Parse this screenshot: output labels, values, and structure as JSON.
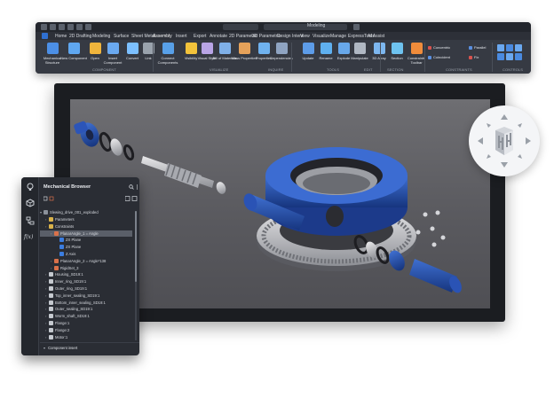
{
  "ribbon": {
    "workspace": "Modeling",
    "tabs": [
      "Home",
      "2D Drafting",
      "Modeling",
      "Surface",
      "Sheet Metal",
      "Assembly",
      "Insert",
      "Export",
      "Annotate",
      "2D Parametric",
      "3D Parametric",
      "Design Intent",
      "View",
      "Visualize",
      "Manage",
      "ExpressTools",
      "AI Assist"
    ],
    "active_tab": "Assembly",
    "tools": [
      "Mechanical Structure",
      "New Component",
      "Open",
      "Insert Component",
      "Convert",
      "Link",
      "Connect Components",
      "Visibility",
      "Visual Style",
      "Bill of Materials",
      "Mass Properties",
      "Properties",
      "Dependencies",
      "Update",
      "Rename",
      "Explode",
      "Manipulate",
      "3D Array",
      "Section",
      "Constraints Toolbar"
    ],
    "constraints": [
      "Concentric",
      "Parallel",
      "Coincident",
      "Fix"
    ],
    "groups": [
      "COMPONENT",
      "VISUALIZE",
      "INQUIRE",
      "TOOLS",
      "EDIT",
      "SECTION",
      "CONSTRAINTS",
      "CONTROLS"
    ],
    "colors": {
      "bg": "#363a43",
      "accent": "#2f6fd0"
    }
  },
  "browser": {
    "title": "Mechanical Browser",
    "root": "Slewing_drive_001_exploded",
    "items": [
      {
        "label": "Parameters",
        "indent": 1,
        "icon": "folder-icon"
      },
      {
        "label": "Constraints",
        "indent": 1,
        "icon": "folder-icon"
      },
      {
        "label": "PlanarAngle_1 = Angle",
        "indent": 2,
        "icon": "constraint-icon",
        "selected": true
      },
      {
        "label": "ZX Plane",
        "indent": 3,
        "icon": "plane-icon"
      },
      {
        "label": "ZX Plane",
        "indent": 3,
        "icon": "plane-icon"
      },
      {
        "label": "Z Axis",
        "indent": 3,
        "icon": "axis-icon"
      },
      {
        "label": "PlanarAngle_2 = Angle*138",
        "indent": 2,
        "icon": "constraint-icon"
      },
      {
        "label": "RigidSet_3",
        "indent": 2,
        "icon": "constraint-icon"
      },
      {
        "label": "Housing_SD19:1",
        "indent": 1,
        "icon": "part-icon"
      },
      {
        "label": "Inner_ring_SD19:1",
        "indent": 1,
        "icon": "part-icon"
      },
      {
        "label": "Outer_ring_SD19:1",
        "indent": 1,
        "icon": "part-icon"
      },
      {
        "label": "Top_inner_sealing_SD19:1",
        "indent": 1,
        "icon": "part-icon"
      },
      {
        "label": "Bottom_inner_sealing_SD19:1",
        "indent": 1,
        "icon": "part-icon"
      },
      {
        "label": "Outer_sealing_SD19:1",
        "indent": 1,
        "icon": "part-icon"
      },
      {
        "label": "Worm_shaft_SD19:1",
        "indent": 1,
        "icon": "part-icon"
      },
      {
        "label": "Flange:1",
        "indent": 1,
        "icon": "part-icon"
      },
      {
        "label": "Flange:2",
        "indent": 1,
        "icon": "part-icon"
      },
      {
        "label": "Motor:1",
        "indent": 1,
        "icon": "part-icon"
      }
    ],
    "footer": "Component insert",
    "sidebar_labels": {
      "fx": "f(x)"
    },
    "colors": {
      "selection": "#5a5f69",
      "link_icon": "#3b7de0",
      "constraint_icon": "#d9714a"
    }
  }
}
